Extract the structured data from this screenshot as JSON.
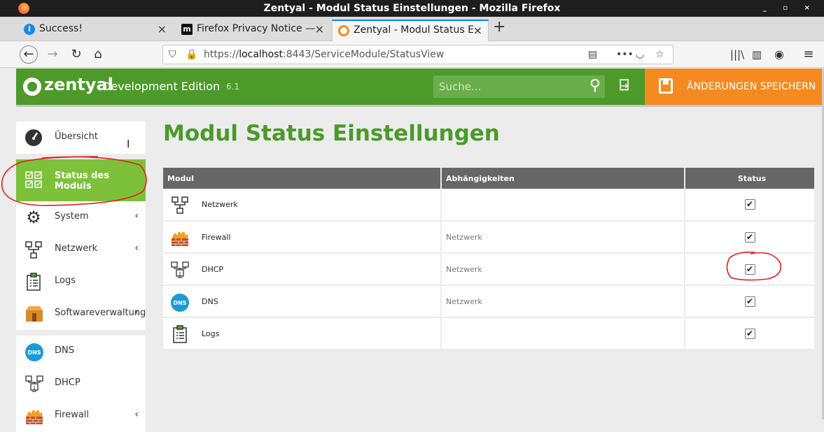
{
  "window": {
    "title": "Zentyal - Modul Status Einstellungen - Mozilla Firefox"
  },
  "tabs": [
    {
      "label": "Success!",
      "icon": "info-icon",
      "color": "#1e88e5"
    },
    {
      "label": "Firefox Privacy Notice —",
      "icon": "mozilla-m-icon",
      "color": "#000000"
    },
    {
      "label": "Zentyal - Modul Status E",
      "icon": "zentyal-icon",
      "color": "#f58a20"
    }
  ],
  "navbar": {
    "url_prefix": "https://",
    "url_host": "localhost",
    "url_rest": ":8443/ServiceModule/StatusView"
  },
  "header": {
    "logo": "zentyal",
    "edition": "Development Edition",
    "version": "6.1",
    "search_placeholder": "Suche...",
    "save_label": "ÄNDERUNGEN SPEICHERN",
    "brand_color": "#4d9a2a",
    "save_color": "#f58a20"
  },
  "sidebar": {
    "items": [
      {
        "label": "Übersicht",
        "icon": "dashboard-gauge-icon"
      },
      {
        "label": "Status des Moduls",
        "icon": "module-status-checkboxes-icon",
        "active": true
      },
      {
        "label": "System",
        "icon": "gear-icon",
        "chevron": "‹"
      },
      {
        "label": "Netzwerk",
        "icon": "network-icon",
        "chevron": "‹"
      },
      {
        "label": "Logs",
        "icon": "clipboard-icon"
      },
      {
        "label": "Softwareverwaltung",
        "icon": "package-box-icon",
        "chevron": "‹"
      },
      {
        "label": "DNS",
        "icon": "dns-icon"
      },
      {
        "label": "DHCP",
        "icon": "dhcp-icon"
      },
      {
        "label": "Firewall",
        "icon": "firewall-icon",
        "chevron": "‹"
      }
    ]
  },
  "page": {
    "title": "Modul Status Einstellungen",
    "columns": [
      "Modul",
      "Abhängigkeiten",
      "Status"
    ],
    "rows": [
      {
        "module": "Netzwerk",
        "deps": "",
        "icon": "network-icon",
        "enabled": true
      },
      {
        "module": "Firewall",
        "deps": "Netzwerk",
        "icon": "firewall-icon",
        "enabled": true
      },
      {
        "module": "DHCP",
        "deps": "Netzwerk",
        "icon": "dhcp-icon",
        "enabled": true
      },
      {
        "module": "DNS",
        "deps": "Netzwerk",
        "icon": "dns-icon",
        "enabled": true
      },
      {
        "module": "Logs",
        "deps": "",
        "icon": "clipboard-icon",
        "enabled": true
      }
    ]
  },
  "annotation_color": "#e02020"
}
